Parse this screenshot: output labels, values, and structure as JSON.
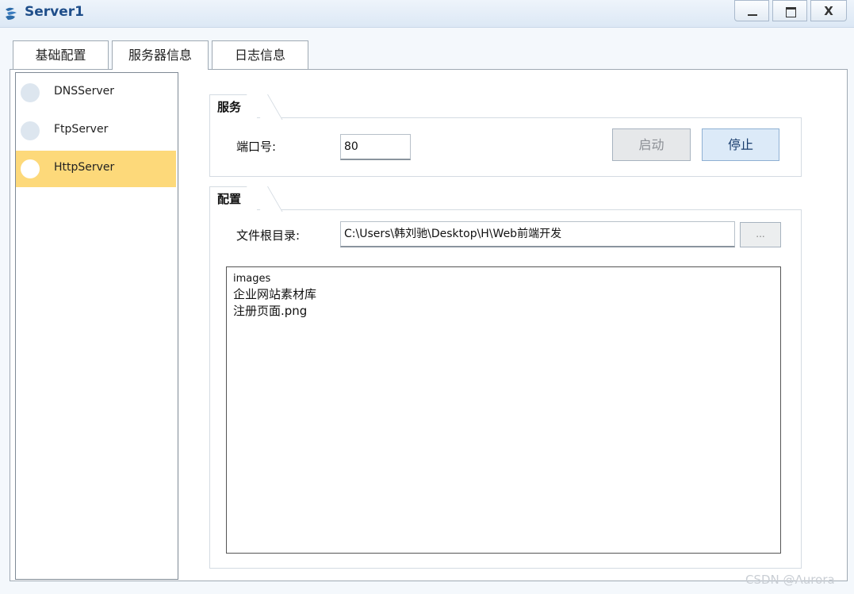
{
  "window": {
    "title": "Server1",
    "minimize": "_",
    "close": "X"
  },
  "tabs": [
    {
      "label": "基础配置"
    },
    {
      "label": "服务器信息"
    },
    {
      "label": "日志信息"
    }
  ],
  "services": [
    {
      "label": "DNSServer",
      "selected": false
    },
    {
      "label": "FtpServer",
      "selected": false
    },
    {
      "label": "HttpServer",
      "selected": true
    }
  ],
  "service_group": {
    "title": "服务",
    "port_label": "端口号:",
    "port_value": "80",
    "start_label": "启动",
    "stop_label": "停止"
  },
  "config_group": {
    "title": "配置",
    "root_label": "文件根目录:",
    "root_value": "C:\\Users\\韩刘驰\\Desktop\\H\\Web前端开发",
    "browse_label": "...",
    "files": [
      "images",
      "企业网站素材库",
      "注册页面.png"
    ]
  },
  "watermark": "CSDN @Aurora",
  "colors": {
    "selected_item": "#fdd97a",
    "title_text": "#1f4e8a"
  }
}
